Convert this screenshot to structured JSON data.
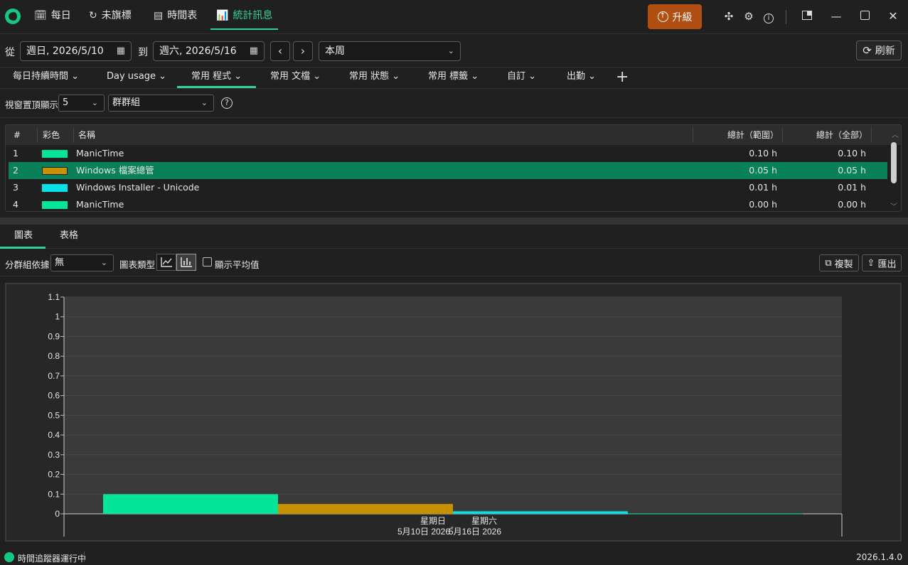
{
  "nav": {
    "tabs": [
      {
        "label": "每日",
        "icon": "calendar-clock-icon"
      },
      {
        "label": "未旗標",
        "icon": "history-icon"
      },
      {
        "label": "時間表",
        "icon": "document-icon"
      },
      {
        "label": "統計訊息",
        "icon": "bar-chart-icon"
      }
    ],
    "active_index": 3,
    "upgrade_label": "升級"
  },
  "daterange": {
    "from_label": "從",
    "from_value": "週日, 2026/5/10",
    "to_label": "到",
    "to_value": "週六, 2026/5/16",
    "period": "本周",
    "refresh_label": "刷新"
  },
  "report_tabs": [
    {
      "label": "每日持續時間"
    },
    {
      "label": "Day usage"
    },
    {
      "label": "常用 程式"
    },
    {
      "label": "常用 文檔"
    },
    {
      "label": "常用 狀態"
    },
    {
      "label": "常用 標籤"
    },
    {
      "label": "自訂"
    },
    {
      "label": "出勤"
    }
  ],
  "active_report_tab": 2,
  "options": {
    "top_label": "視窗置頂顯示",
    "top_value": "5",
    "group_value": "群群組"
  },
  "table": {
    "headers": {
      "num": "#",
      "color": "彩色",
      "name": "名稱",
      "total_range": "總計（範圍）",
      "total_all": "總計（全部）"
    },
    "rows": [
      {
        "num": "1",
        "color": "#05e59a",
        "name": "ManicTime",
        "total_range": "0.10 h",
        "total_all": "0.10 h"
      },
      {
        "num": "2",
        "color": "#c79100",
        "name": "Windows 檔案總管",
        "total_range": "0.05 h",
        "total_all": "0.05 h"
      },
      {
        "num": "3",
        "color": "#06e1e8",
        "name": "Windows Installer - Unicode",
        "total_range": "0.01 h",
        "total_all": "0.01 h"
      },
      {
        "num": "4",
        "color": "#05e59a",
        "name": "ManicTime",
        "total_range": "0.00 h",
        "total_all": "0.00 h"
      }
    ],
    "selected_row": 1
  },
  "view_tabs": [
    {
      "label": "圖表"
    },
    {
      "label": "表格"
    }
  ],
  "chart_options": {
    "group_by_label": "分群組依據",
    "group_by_value": "無",
    "chart_type_label": "圖表類型",
    "show_avg_label": "顯示平均值",
    "copy_label": "複製",
    "export_label": "匯出"
  },
  "chart_data": {
    "type": "bar",
    "ylim": [
      0,
      1.1
    ],
    "y_ticks": [
      "0",
      "0.1",
      "0.2",
      "0.3",
      "0.4",
      "0.5",
      "0.6",
      "0.7",
      "0.8",
      "0.9",
      "1",
      "1.1"
    ],
    "x_labels": [
      {
        "day": "星期日",
        "date": "5月10日 2026"
      },
      {
        "day": "星期六",
        "date": "5月16日 2026"
      }
    ],
    "x_separator": "-",
    "series": [
      {
        "name": "ManicTime",
        "color": "#05e59a",
        "value": 0.1
      },
      {
        "name": "Windows 檔案總管",
        "color": "#c79100",
        "value": 0.05
      },
      {
        "name": "Windows Installer - Unicode",
        "color": "#06e1e8",
        "value": 0.013
      },
      {
        "name": "ManicTime",
        "color": "#05e59a",
        "value": 0.002
      }
    ]
  },
  "status": {
    "running_text": "時間追蹤器運行中",
    "version": "2026.1.4.0"
  }
}
